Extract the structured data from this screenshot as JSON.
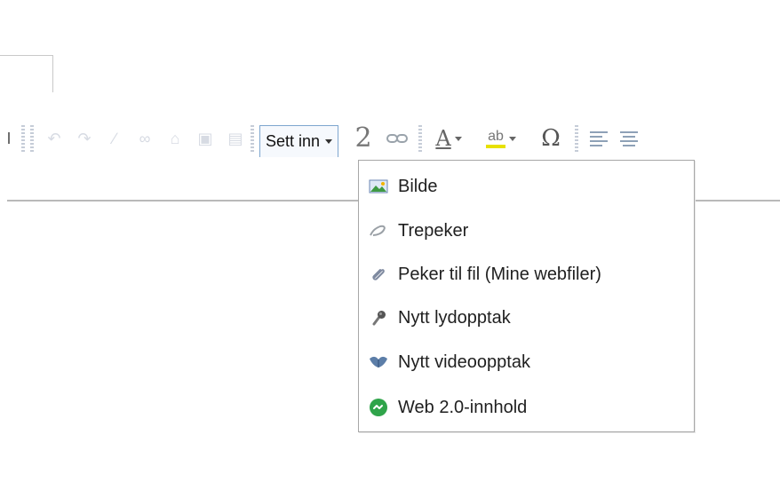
{
  "toolbar": {
    "left_symbol": "I",
    "sett_inn_label": "Sett inn",
    "superscript_symbol": "2",
    "text_color_symbol": "A",
    "highlight_symbol": "ab",
    "omega_symbol": "Ω"
  },
  "dropdown": {
    "items": [
      {
        "label": "Bilde",
        "icon": "image-icon"
      },
      {
        "label": "Trepeker",
        "icon": "trail-icon"
      },
      {
        "label": "Peker til fil (Mine webfiler)",
        "icon": "paperclip-icon"
      },
      {
        "label": "Nytt lydopptak",
        "icon": "microphone-icon"
      },
      {
        "label": "Nytt videoopptak",
        "icon": "video-icon"
      },
      {
        "label": "Web 2.0-innhold",
        "icon": "web-icon"
      }
    ]
  },
  "colors": {
    "accent_border": "#7ea6cf",
    "menu_border": "#a7a7a7",
    "highlight_yellow": "#e7e100",
    "web_green": "#2fa44a"
  }
}
